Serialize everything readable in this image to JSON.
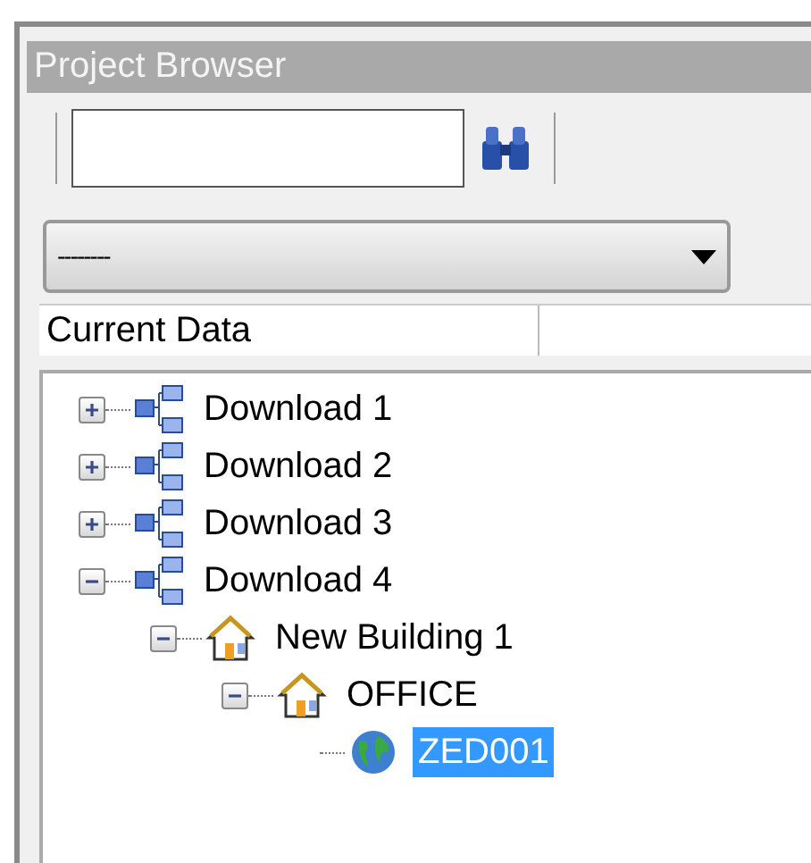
{
  "panel": {
    "title": "Project Browser"
  },
  "dropdown": {
    "value": "--------"
  },
  "columns": [
    "Current Data"
  ],
  "tree": [
    {
      "label": "Download 1",
      "kind": "network",
      "expanded": false,
      "selected": false
    },
    {
      "label": "Download 2",
      "kind": "network",
      "expanded": false,
      "selected": false
    },
    {
      "label": "Download 3",
      "kind": "network",
      "expanded": false,
      "selected": false
    },
    {
      "label": "Download 4",
      "kind": "network",
      "expanded": true,
      "selected": false,
      "children": [
        {
          "label": "New Building 1",
          "kind": "house",
          "expanded": true,
          "selected": false,
          "children": [
            {
              "label": "OFFICE",
              "kind": "house",
              "expanded": true,
              "selected": false,
              "children": [
                {
                  "label": "ZED001",
                  "kind": "globe",
                  "selected": true
                }
              ]
            }
          ]
        }
      ]
    }
  ]
}
